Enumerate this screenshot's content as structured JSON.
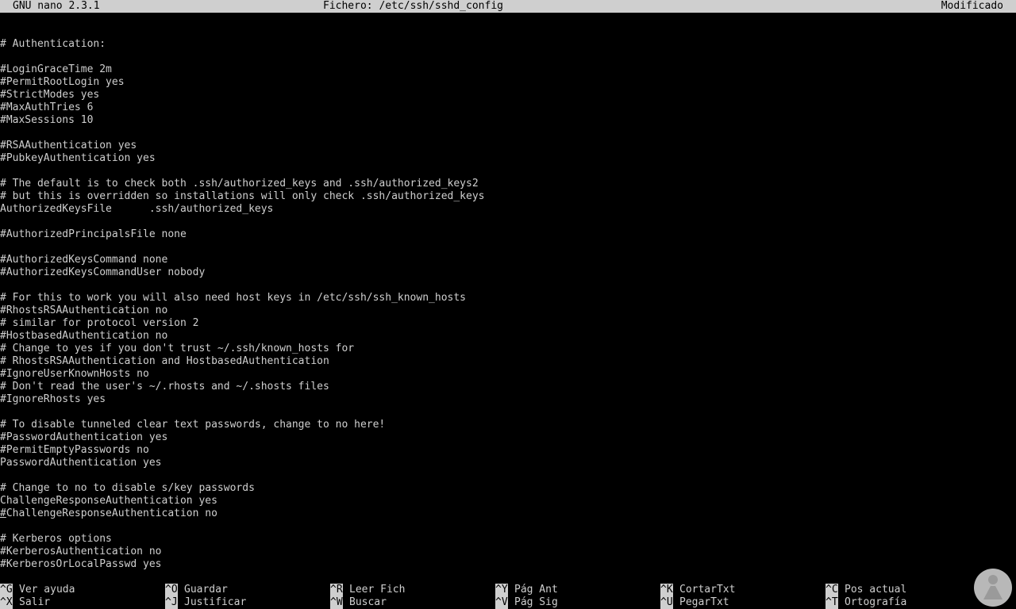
{
  "titlebar": {
    "app": "GNU nano 2.3.1",
    "file": "Fichero: /etc/ssh/sshd_config",
    "status": "Modificado"
  },
  "editor": {
    "lines": [
      "# Authentication:",
      "",
      "#LoginGraceTime 2m",
      "#PermitRootLogin yes",
      "#StrictModes yes",
      "#MaxAuthTries 6",
      "#MaxSessions 10",
      "",
      "#RSAAuthentication yes",
      "#PubkeyAuthentication yes",
      "",
      "# The default is to check both .ssh/authorized_keys and .ssh/authorized_keys2",
      "# but this is overridden so installations will only check .ssh/authorized_keys",
      "AuthorizedKeysFile      .ssh/authorized_keys",
      "",
      "#AuthorizedPrincipalsFile none",
      "",
      "#AuthorizedKeysCommand none",
      "#AuthorizedKeysCommandUser nobody",
      "",
      "# For this to work you will also need host keys in /etc/ssh/ssh_known_hosts",
      "#RhostsRSAAuthentication no",
      "# similar for protocol version 2",
      "#HostbasedAuthentication no",
      "# Change to yes if you don't trust ~/.ssh/known_hosts for",
      "# RhostsRSAAuthentication and HostbasedAuthentication",
      "#IgnoreUserKnownHosts no",
      "# Don't read the user's ~/.rhosts and ~/.shosts files",
      "#IgnoreRhosts yes",
      "",
      "# To disable tunneled clear text passwords, change to no here!",
      "#PasswordAuthentication yes",
      "#PermitEmptyPasswords no",
      "PasswordAuthentication yes",
      "",
      "# Change to no to disable s/key passwords",
      "ChallengeResponseAuthentication yes",
      "#ChallengeResponseAuthentication no",
      "",
      "# Kerberos options",
      "#KerberosAuthentication no",
      "#KerberosOrLocalPasswd yes"
    ],
    "cursor_line_index": 37
  },
  "shortcuts": [
    {
      "key": "^G",
      "label": "Ver ayuda"
    },
    {
      "key": "^X",
      "label": "Salir"
    },
    {
      "key": "^O",
      "label": "Guardar"
    },
    {
      "key": "^J",
      "label": "Justificar"
    },
    {
      "key": "^R",
      "label": "Leer Fich"
    },
    {
      "key": "^W",
      "label": "Buscar"
    },
    {
      "key": "^Y",
      "label": "Pág Ant"
    },
    {
      "key": "^V",
      "label": "Pág Sig"
    },
    {
      "key": "^K",
      "label": "CortarTxt"
    },
    {
      "key": "^U",
      "label": "PegarTxt"
    },
    {
      "key": "^C",
      "label": "Pos actual"
    },
    {
      "key": "^T",
      "label": "Ortografía"
    }
  ],
  "colors": {
    "background": "#000000",
    "text": "#cfcfcf",
    "bar": "#cfcfcf"
  },
  "logo": {
    "icon": "person-logo-icon"
  }
}
